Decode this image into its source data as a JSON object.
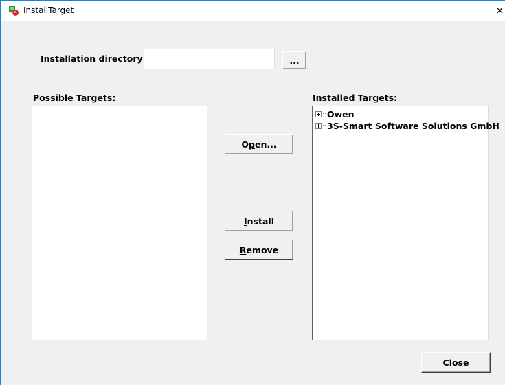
{
  "window": {
    "title": "InstallTarget",
    "close_glyph": "×"
  },
  "install_dir": {
    "label": "Installation directory:",
    "value": "",
    "browse_label": "..."
  },
  "possible_targets": {
    "label": "Possible Targets:",
    "items": []
  },
  "installed_targets": {
    "label": "Installed Targets:",
    "items": [
      {
        "label": "Owen",
        "expander": "plus"
      },
      {
        "label": "3S-Smart Software Solutions GmbH",
        "expander": "plus"
      }
    ]
  },
  "buttons": {
    "open": {
      "mnemonic_before": "O",
      "mnemonic": "p",
      "after": "en..."
    },
    "install": {
      "mnemonic_before": "",
      "mnemonic": "I",
      "after": "nstall"
    },
    "remove": {
      "mnemonic_before": "",
      "mnemonic": "R",
      "after": "emove"
    },
    "close": "Close"
  },
  "colors": {
    "window_bg": "#f0f0f0",
    "title_border": "#1883d7"
  }
}
